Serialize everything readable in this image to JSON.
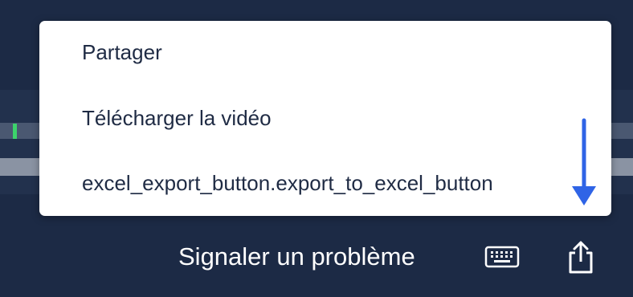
{
  "menu": {
    "items": [
      {
        "label": "Partager"
      },
      {
        "label": "Télécharger la vidéo"
      },
      {
        "label": "excel_export_button.export_to_excel_button"
      }
    ]
  },
  "footer": {
    "report_link": "Signaler un problème",
    "keyboard_icon": "keyboard-icon",
    "share_icon": "share-icon"
  },
  "annotation": {
    "arrow_icon": "down-arrow-icon",
    "arrow_color": "#2f64e6"
  },
  "colors": {
    "background": "#1c2a45",
    "menu_text": "#1f2b44",
    "accent_green": "#3cd36b"
  }
}
